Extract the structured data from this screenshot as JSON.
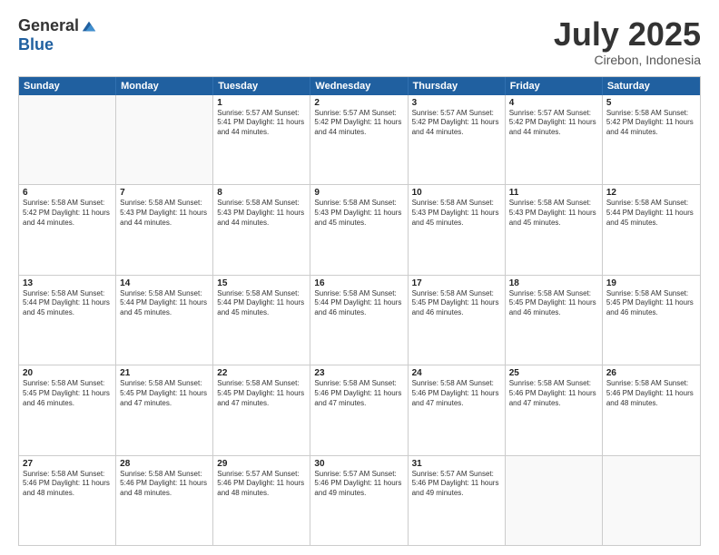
{
  "logo": {
    "general": "General",
    "blue": "Blue"
  },
  "title": {
    "month": "July 2025",
    "location": "Cirebon, Indonesia"
  },
  "header_days": [
    "Sunday",
    "Monday",
    "Tuesday",
    "Wednesday",
    "Thursday",
    "Friday",
    "Saturday"
  ],
  "weeks": [
    [
      {
        "day": "",
        "info": ""
      },
      {
        "day": "",
        "info": ""
      },
      {
        "day": "1",
        "info": "Sunrise: 5:57 AM\nSunset: 5:41 PM\nDaylight: 11 hours and 44 minutes."
      },
      {
        "day": "2",
        "info": "Sunrise: 5:57 AM\nSunset: 5:42 PM\nDaylight: 11 hours and 44 minutes."
      },
      {
        "day": "3",
        "info": "Sunrise: 5:57 AM\nSunset: 5:42 PM\nDaylight: 11 hours and 44 minutes."
      },
      {
        "day": "4",
        "info": "Sunrise: 5:57 AM\nSunset: 5:42 PM\nDaylight: 11 hours and 44 minutes."
      },
      {
        "day": "5",
        "info": "Sunrise: 5:58 AM\nSunset: 5:42 PM\nDaylight: 11 hours and 44 minutes."
      }
    ],
    [
      {
        "day": "6",
        "info": "Sunrise: 5:58 AM\nSunset: 5:42 PM\nDaylight: 11 hours and 44 minutes."
      },
      {
        "day": "7",
        "info": "Sunrise: 5:58 AM\nSunset: 5:43 PM\nDaylight: 11 hours and 44 minutes."
      },
      {
        "day": "8",
        "info": "Sunrise: 5:58 AM\nSunset: 5:43 PM\nDaylight: 11 hours and 44 minutes."
      },
      {
        "day": "9",
        "info": "Sunrise: 5:58 AM\nSunset: 5:43 PM\nDaylight: 11 hours and 45 minutes."
      },
      {
        "day": "10",
        "info": "Sunrise: 5:58 AM\nSunset: 5:43 PM\nDaylight: 11 hours and 45 minutes."
      },
      {
        "day": "11",
        "info": "Sunrise: 5:58 AM\nSunset: 5:43 PM\nDaylight: 11 hours and 45 minutes."
      },
      {
        "day": "12",
        "info": "Sunrise: 5:58 AM\nSunset: 5:44 PM\nDaylight: 11 hours and 45 minutes."
      }
    ],
    [
      {
        "day": "13",
        "info": "Sunrise: 5:58 AM\nSunset: 5:44 PM\nDaylight: 11 hours and 45 minutes."
      },
      {
        "day": "14",
        "info": "Sunrise: 5:58 AM\nSunset: 5:44 PM\nDaylight: 11 hours and 45 minutes."
      },
      {
        "day": "15",
        "info": "Sunrise: 5:58 AM\nSunset: 5:44 PM\nDaylight: 11 hours and 45 minutes."
      },
      {
        "day": "16",
        "info": "Sunrise: 5:58 AM\nSunset: 5:44 PM\nDaylight: 11 hours and 46 minutes."
      },
      {
        "day": "17",
        "info": "Sunrise: 5:58 AM\nSunset: 5:45 PM\nDaylight: 11 hours and 46 minutes."
      },
      {
        "day": "18",
        "info": "Sunrise: 5:58 AM\nSunset: 5:45 PM\nDaylight: 11 hours and 46 minutes."
      },
      {
        "day": "19",
        "info": "Sunrise: 5:58 AM\nSunset: 5:45 PM\nDaylight: 11 hours and 46 minutes."
      }
    ],
    [
      {
        "day": "20",
        "info": "Sunrise: 5:58 AM\nSunset: 5:45 PM\nDaylight: 11 hours and 46 minutes."
      },
      {
        "day": "21",
        "info": "Sunrise: 5:58 AM\nSunset: 5:45 PM\nDaylight: 11 hours and 47 minutes."
      },
      {
        "day": "22",
        "info": "Sunrise: 5:58 AM\nSunset: 5:45 PM\nDaylight: 11 hours and 47 minutes."
      },
      {
        "day": "23",
        "info": "Sunrise: 5:58 AM\nSunset: 5:46 PM\nDaylight: 11 hours and 47 minutes."
      },
      {
        "day": "24",
        "info": "Sunrise: 5:58 AM\nSunset: 5:46 PM\nDaylight: 11 hours and 47 minutes."
      },
      {
        "day": "25",
        "info": "Sunrise: 5:58 AM\nSunset: 5:46 PM\nDaylight: 11 hours and 47 minutes."
      },
      {
        "day": "26",
        "info": "Sunrise: 5:58 AM\nSunset: 5:46 PM\nDaylight: 11 hours and 48 minutes."
      }
    ],
    [
      {
        "day": "27",
        "info": "Sunrise: 5:58 AM\nSunset: 5:46 PM\nDaylight: 11 hours and 48 minutes."
      },
      {
        "day": "28",
        "info": "Sunrise: 5:58 AM\nSunset: 5:46 PM\nDaylight: 11 hours and 48 minutes."
      },
      {
        "day": "29",
        "info": "Sunrise: 5:57 AM\nSunset: 5:46 PM\nDaylight: 11 hours and 48 minutes."
      },
      {
        "day": "30",
        "info": "Sunrise: 5:57 AM\nSunset: 5:46 PM\nDaylight: 11 hours and 49 minutes."
      },
      {
        "day": "31",
        "info": "Sunrise: 5:57 AM\nSunset: 5:46 PM\nDaylight: 11 hours and 49 minutes."
      },
      {
        "day": "",
        "info": ""
      },
      {
        "day": "",
        "info": ""
      }
    ]
  ]
}
